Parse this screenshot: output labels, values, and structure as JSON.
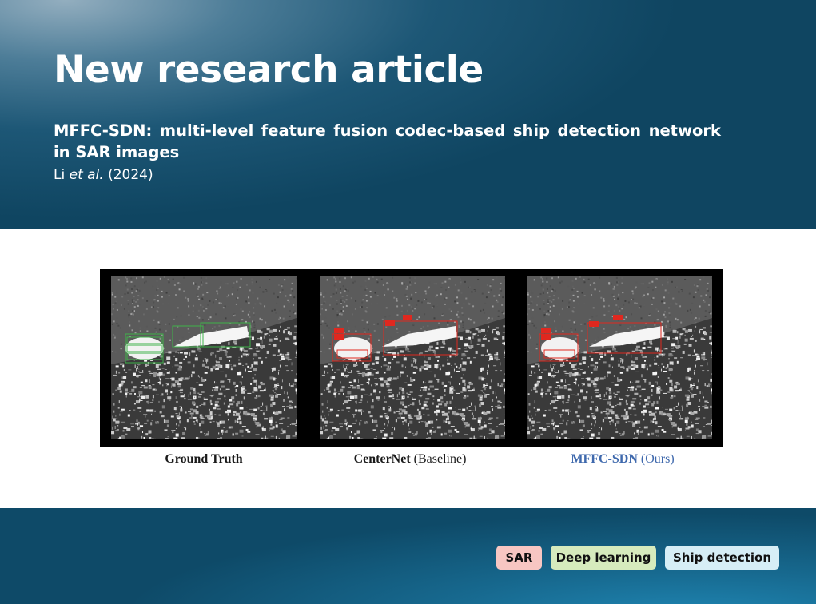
{
  "header": {
    "title": "New research article",
    "subtitle": "MFFC-SDN: multi-level feature fusion codec-based ship detection network in SAR images",
    "authors_prefix": "Li ",
    "authors_etal": "et al.",
    "authors_year": " (2024)"
  },
  "figure": {
    "captions": [
      {
        "bold": "Ground Truth",
        "normal": ""
      },
      {
        "bold": "CenterNet",
        "normal": " (Baseline)"
      },
      {
        "bold": "MFFC-SDN",
        "normal": " (Ours)"
      }
    ],
    "colors": {
      "ground_truth_box": "#3fb34a",
      "detection_box": "#e0281f",
      "ours_caption": "#3f69ad"
    }
  },
  "tags": [
    {
      "label": "SAR",
      "color": "#f7c6c2"
    },
    {
      "label": "Deep learning",
      "color": "#d6ebbd"
    },
    {
      "label": "Ship detection",
      "color": "#d6eef6"
    }
  ]
}
